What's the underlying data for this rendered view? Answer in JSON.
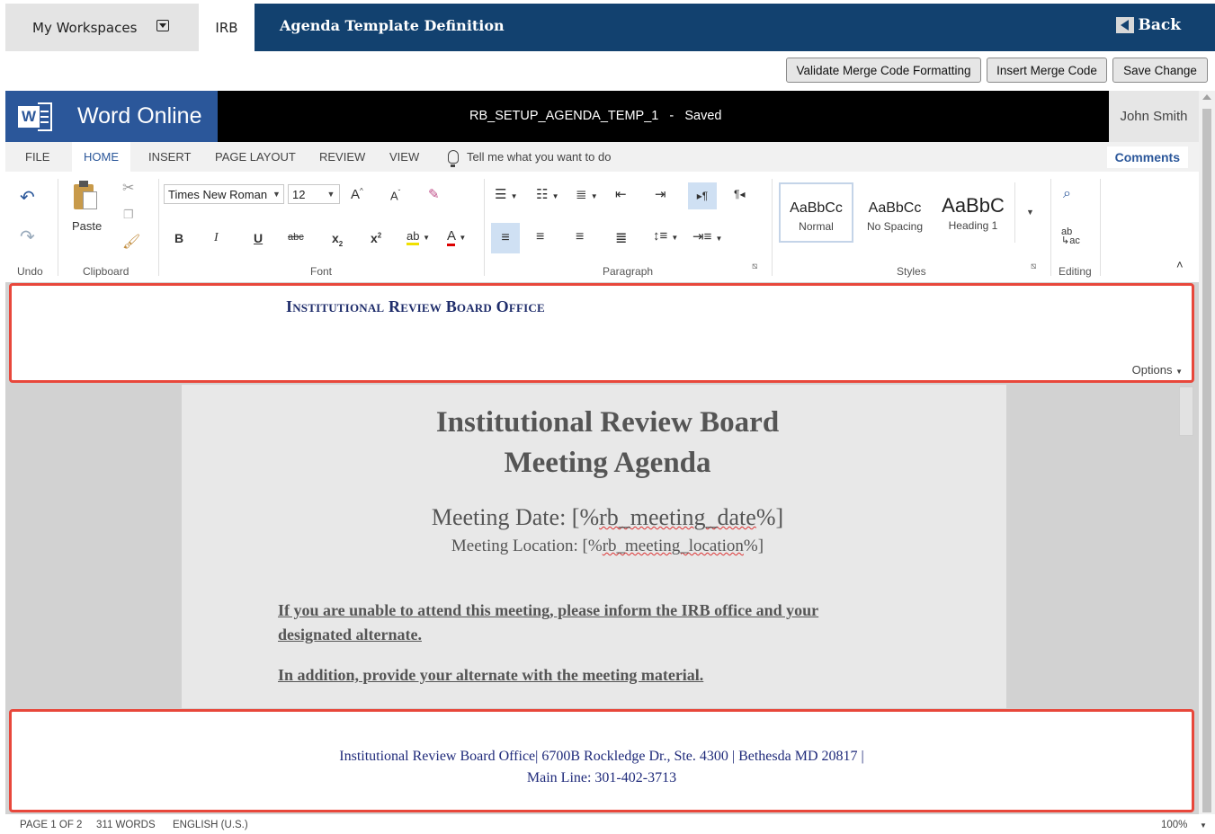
{
  "nav": {
    "workspaces_label": "My Workspaces",
    "irb_tab": "IRB",
    "page_title": "Agenda Template Definition",
    "back_label": "Back"
  },
  "actions": {
    "validate": "Validate Merge Code Formatting",
    "insert": "Insert Merge Code",
    "save": "Save Change"
  },
  "word": {
    "app_name": "Word Online",
    "doc_name": "RB_SETUP_AGENDA_TEMP_1",
    "separator": "-",
    "save_status": "Saved",
    "user": "John Smith",
    "logo_letter": "W"
  },
  "ribbon": {
    "tabs": [
      "FILE",
      "HOME",
      "INSERT",
      "PAGE LAYOUT",
      "REVIEW",
      "VIEW"
    ],
    "tell_me": "Tell me what you want to do",
    "comments": "Comments",
    "paste": "Paste",
    "font_name": "Times New Roman",
    "font_size": "12",
    "groups": {
      "undo": "Undo",
      "clipboard": "Clipboard",
      "font": "Font",
      "paragraph": "Paragraph",
      "styles": "Styles",
      "editing": "Editing"
    },
    "styles": [
      {
        "preview": "AaBbCc",
        "name": "Normal"
      },
      {
        "preview": "AaBbCc",
        "name": "No Spacing"
      },
      {
        "preview": "AaBbC",
        "name": "Heading 1"
      }
    ],
    "font_buttons": {
      "bold": "B",
      "italic": "I",
      "underline": "U",
      "strike": "abc",
      "sub": "x",
      "sup": "x"
    }
  },
  "document": {
    "header_text": "Institutional Review Board Office",
    "options_label": "Options",
    "title_line1": "Institutional Review Board",
    "title_line2": "Meeting Agenda",
    "date_prefix": "Meeting Date: [%",
    "date_code": "rb_meeting_date",
    "date_suffix": "%]",
    "location_prefix": "Meeting Location: [%",
    "location_code": "rb_meeting_location",
    "location_suffix": "%]",
    "notice_line1": "If you are unable to attend this meeting, please inform the IRB office and your",
    "notice_line2": "designated alternate.",
    "notice_line3": "In addition, provide your alternate with the meeting material.",
    "footer_line1": "Institutional Review Board Office| 6700B Rockledge Dr., Ste. 4300 | Bethesda MD 20817 |",
    "footer_line2": "Main Line: 301-402-3713"
  },
  "status": {
    "page": "PAGE 1 OF 2",
    "words": "311 WORDS",
    "language": "ENGLISH (U.S.)",
    "zoom": "100%"
  },
  "colors": {
    "nav_blue": "#12416f",
    "word_blue": "#2b579a",
    "highlight_red": "#e8473b",
    "header_text": "#1f2d6b"
  }
}
